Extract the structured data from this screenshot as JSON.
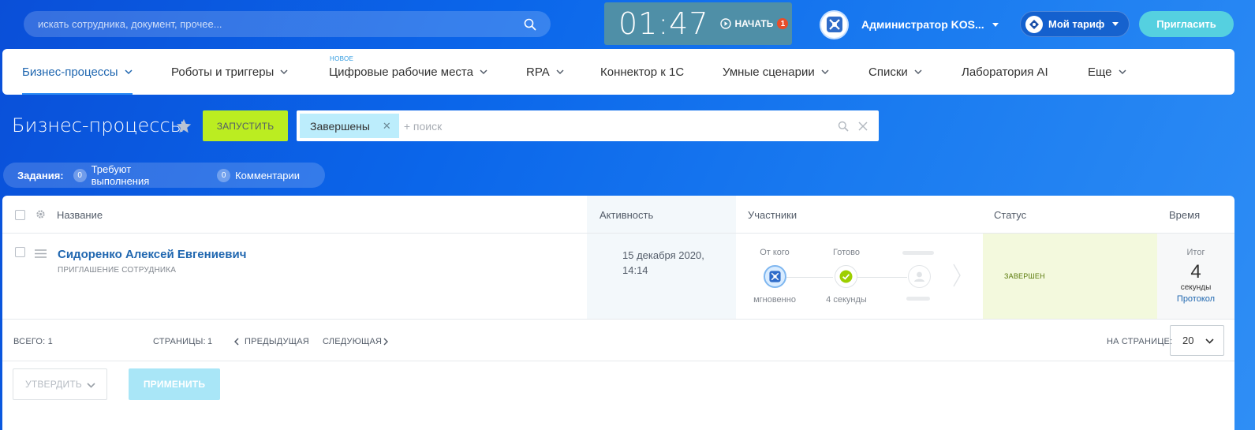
{
  "topbar": {
    "search_placeholder": "искать сотрудника, документ, прочее...",
    "timer_time": "01:47",
    "timer_start_label": "НАЧАТЬ",
    "timer_badge": "1",
    "user_name": "Администратор KOS...",
    "tariff_label": "Мой тариф",
    "invite_label": "Пригласить"
  },
  "nav": {
    "items": [
      {
        "label": "Бизнес-процессы"
      },
      {
        "label": "Роботы и триггеры"
      },
      {
        "label": "Цифровые рабочие места",
        "badge": "НОВОЕ"
      },
      {
        "label": "RPA"
      },
      {
        "label": "Коннектор к 1С"
      },
      {
        "label": "Умные сценарии"
      },
      {
        "label": "Списки"
      },
      {
        "label": "Лаборатория AI"
      },
      {
        "label": "Еще"
      }
    ]
  },
  "page": {
    "title": "Бизнес-процессы",
    "run_label": "ЗАПУСТИТЬ",
    "filter_tag": "Завершены",
    "filter_placeholder": "+ поиск"
  },
  "tasks": {
    "label": "Задания:",
    "items": [
      {
        "count": "0",
        "label": "Требуют выполнения"
      },
      {
        "count": "0",
        "label": "Комментарии"
      }
    ]
  },
  "grid": {
    "columns": [
      "Название",
      "Активность",
      "Участники",
      "Статус",
      "Время"
    ],
    "rows": [
      {
        "title": "Сидоренко Алексей Евгениевич",
        "subtitle": "ПРИГЛАШЕНИЕ СОТРУДНИКА",
        "activity": "15 декабря 2020, 14:14",
        "participants": {
          "from_label": "От кого",
          "from_time": "мгновенно",
          "done_label": "Готово",
          "done_time": "4 секунды"
        },
        "status": "ЗАВЕРШЕН",
        "time_label": "Итог",
        "time_value": "4",
        "time_unit": "секунды",
        "time_link": "Протокол"
      }
    ]
  },
  "footer": {
    "total": "ВСЕГО: 1",
    "pages_label": "СТРАНИЦЫ:",
    "page": "1",
    "prev": "ПРЕДЫДУЩАЯ",
    "next": "СЛЕДУЮЩАЯ",
    "per_page_label": "НА СТРАНИЦЕ:",
    "per_page_value": "20"
  },
  "actions": {
    "approve_label": "УТВЕРДИТЬ",
    "apply_label": "ПРИМЕНИТЬ"
  },
  "colors": {
    "accent": "#2f8ef5",
    "run_button": "#bbed21",
    "link": "#2067b0",
    "status_bg": "#f3f9dd"
  }
}
